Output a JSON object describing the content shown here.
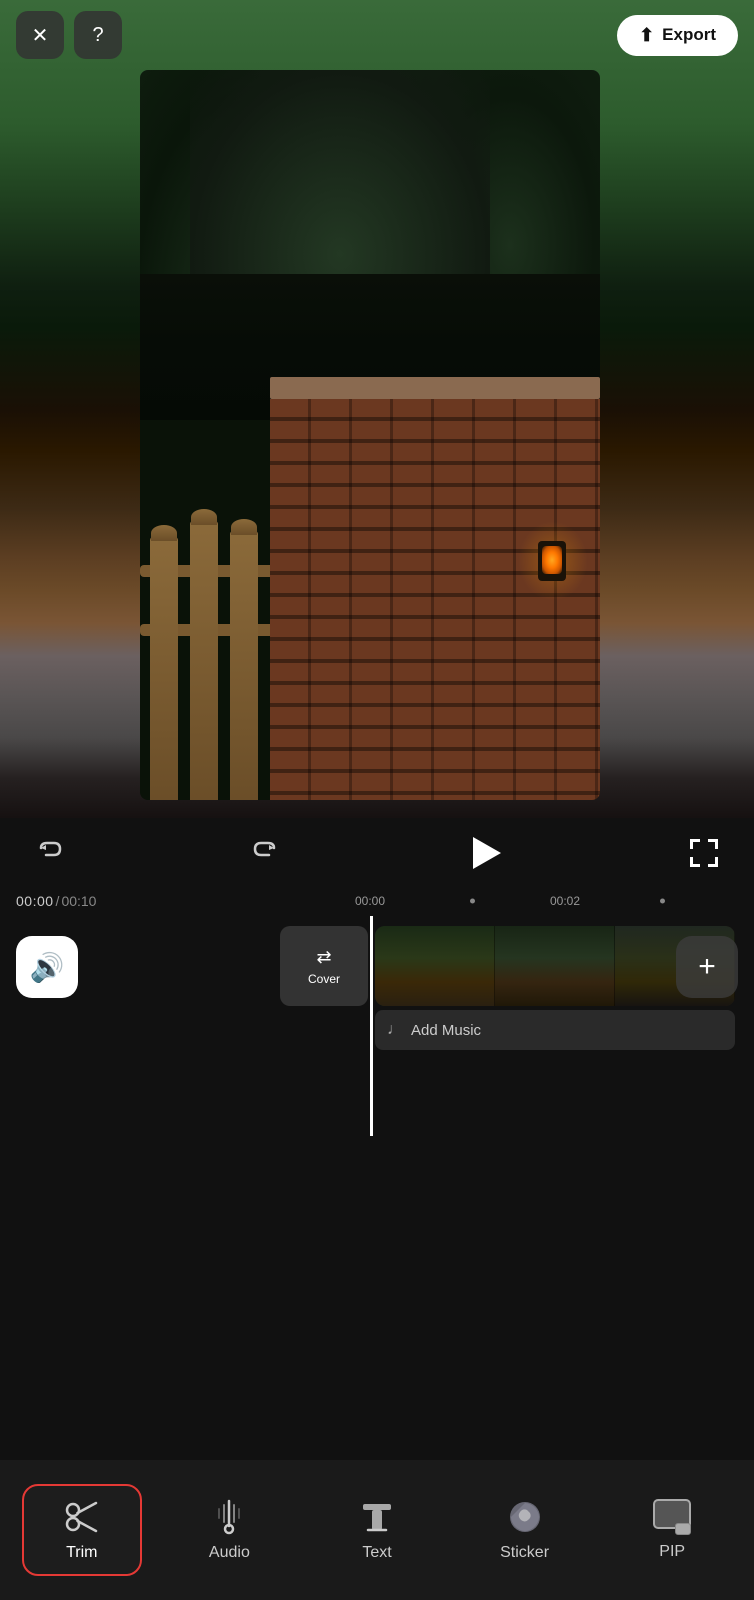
{
  "header": {
    "close_label": "✕",
    "help_label": "?",
    "export_label": "Export"
  },
  "controls": {
    "undo_label": "↺",
    "redo_label": "↻",
    "play_label": "▶",
    "fullscreen_label": "⛶"
  },
  "timeline": {
    "time_current": "00:00",
    "time_divider": "/",
    "time_total": "00:10",
    "marker_0": "00:00",
    "marker_2": "00:02",
    "cover_label": "Cover",
    "add_music_label": "Add Music"
  },
  "toolbar": {
    "trim_label": "Trim",
    "audio_label": "Audio",
    "text_label": "Text",
    "sticker_label": "Sticker",
    "pip_label": "PIP"
  }
}
